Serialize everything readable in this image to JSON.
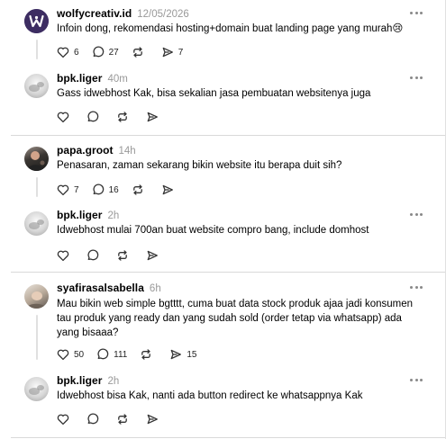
{
  "posts": [
    {
      "user": "wolfycreativ.id",
      "time": "12/05/2026",
      "text": "Infoin dong, rekomendasi hosting+domain buat landing page yang murah😢",
      "likes": "6",
      "comments": "27",
      "shares": "7",
      "avatar": "wolf-logo-avatar"
    },
    {
      "user": "bpk.liger",
      "time": "40m",
      "text": "Gass idwebhost Kak, bisa sekalian jasa pembuatan websitenya juga",
      "avatar": "photo-avatar"
    },
    {
      "user": "papa.groot",
      "time": "14h",
      "text": "Penasaran, zaman sekarang bikin website itu berapa duit sih?",
      "likes": "7",
      "comments": "16",
      "avatar": "photo-avatar"
    },
    {
      "user": "bpk.liger",
      "time": "2h",
      "text": "Idwebhost mulai 700an buat website compro bang, include domhost",
      "avatar": "photo-avatar"
    },
    {
      "user": "syafirasalsabella",
      "time": "6h",
      "text": "Mau bikin web simple bgtttt, cuma buat data stock produk ajaa jadi konsumen tau produk yang ready dan yang sudah sold (order tetap via whatsapp) ada yang bisaaa?",
      "likes": "50",
      "comments": "111",
      "shares": "15",
      "avatar": "photo-avatar"
    },
    {
      "user": "bpk.liger",
      "time": "2h",
      "text": "Idwebhost bisa Kak, nanti ada button redirect ke whatsappnya Kak",
      "avatar": "photo-avatar"
    }
  ],
  "icons": {
    "like": "heart-icon",
    "comment": "comment-icon",
    "repost": "repost-icon",
    "share": "share-icon",
    "more": "more-icon"
  },
  "colors": {
    "text": "#000000",
    "muted": "#999999",
    "separator": "#d9d9d9",
    "icon": "#333333",
    "wolf_logo_bg": "#3d2d62"
  }
}
